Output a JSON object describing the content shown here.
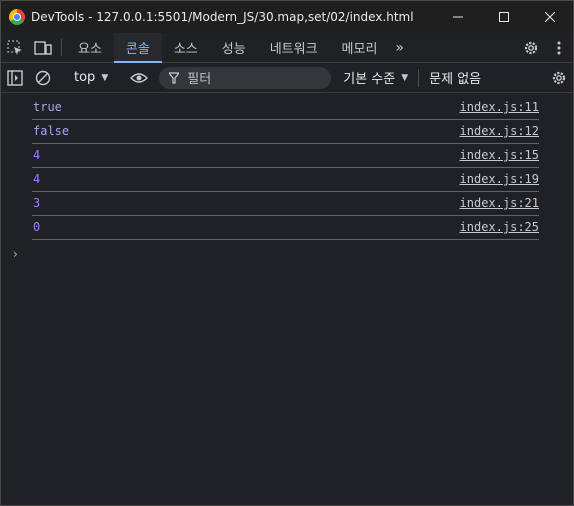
{
  "window": {
    "title": "DevTools - 127.0.0.1:5501/Modern_JS/30.map,set/02/index.html",
    "minimize": "—",
    "maximize": "☐",
    "close": "✕"
  },
  "tabs": [
    {
      "label": "요소",
      "active": false
    },
    {
      "label": "콘솔",
      "active": true
    },
    {
      "label": "소스",
      "active": false
    },
    {
      "label": "성능",
      "active": false
    },
    {
      "label": "네트워크",
      "active": false
    },
    {
      "label": "메모리",
      "active": false
    }
  ],
  "more_tabs": "»",
  "console_toolbar": {
    "context": "top",
    "filter_placeholder": "필터",
    "levels": "기본 수준",
    "issues": "문제 없음"
  },
  "logs": [
    {
      "value": "true",
      "source": "index.js:11"
    },
    {
      "value": "false",
      "source": "index.js:12"
    },
    {
      "value": "4",
      "source": "index.js:15"
    },
    {
      "value": "4",
      "source": "index.js:19"
    },
    {
      "value": "3",
      "source": "index.js:21"
    },
    {
      "value": "0",
      "source": "index.js:25"
    }
  ],
  "prompt": "›",
  "colors": {
    "background": "#202124",
    "accent": "#8ab4f8",
    "log_value": "#9980ff"
  }
}
